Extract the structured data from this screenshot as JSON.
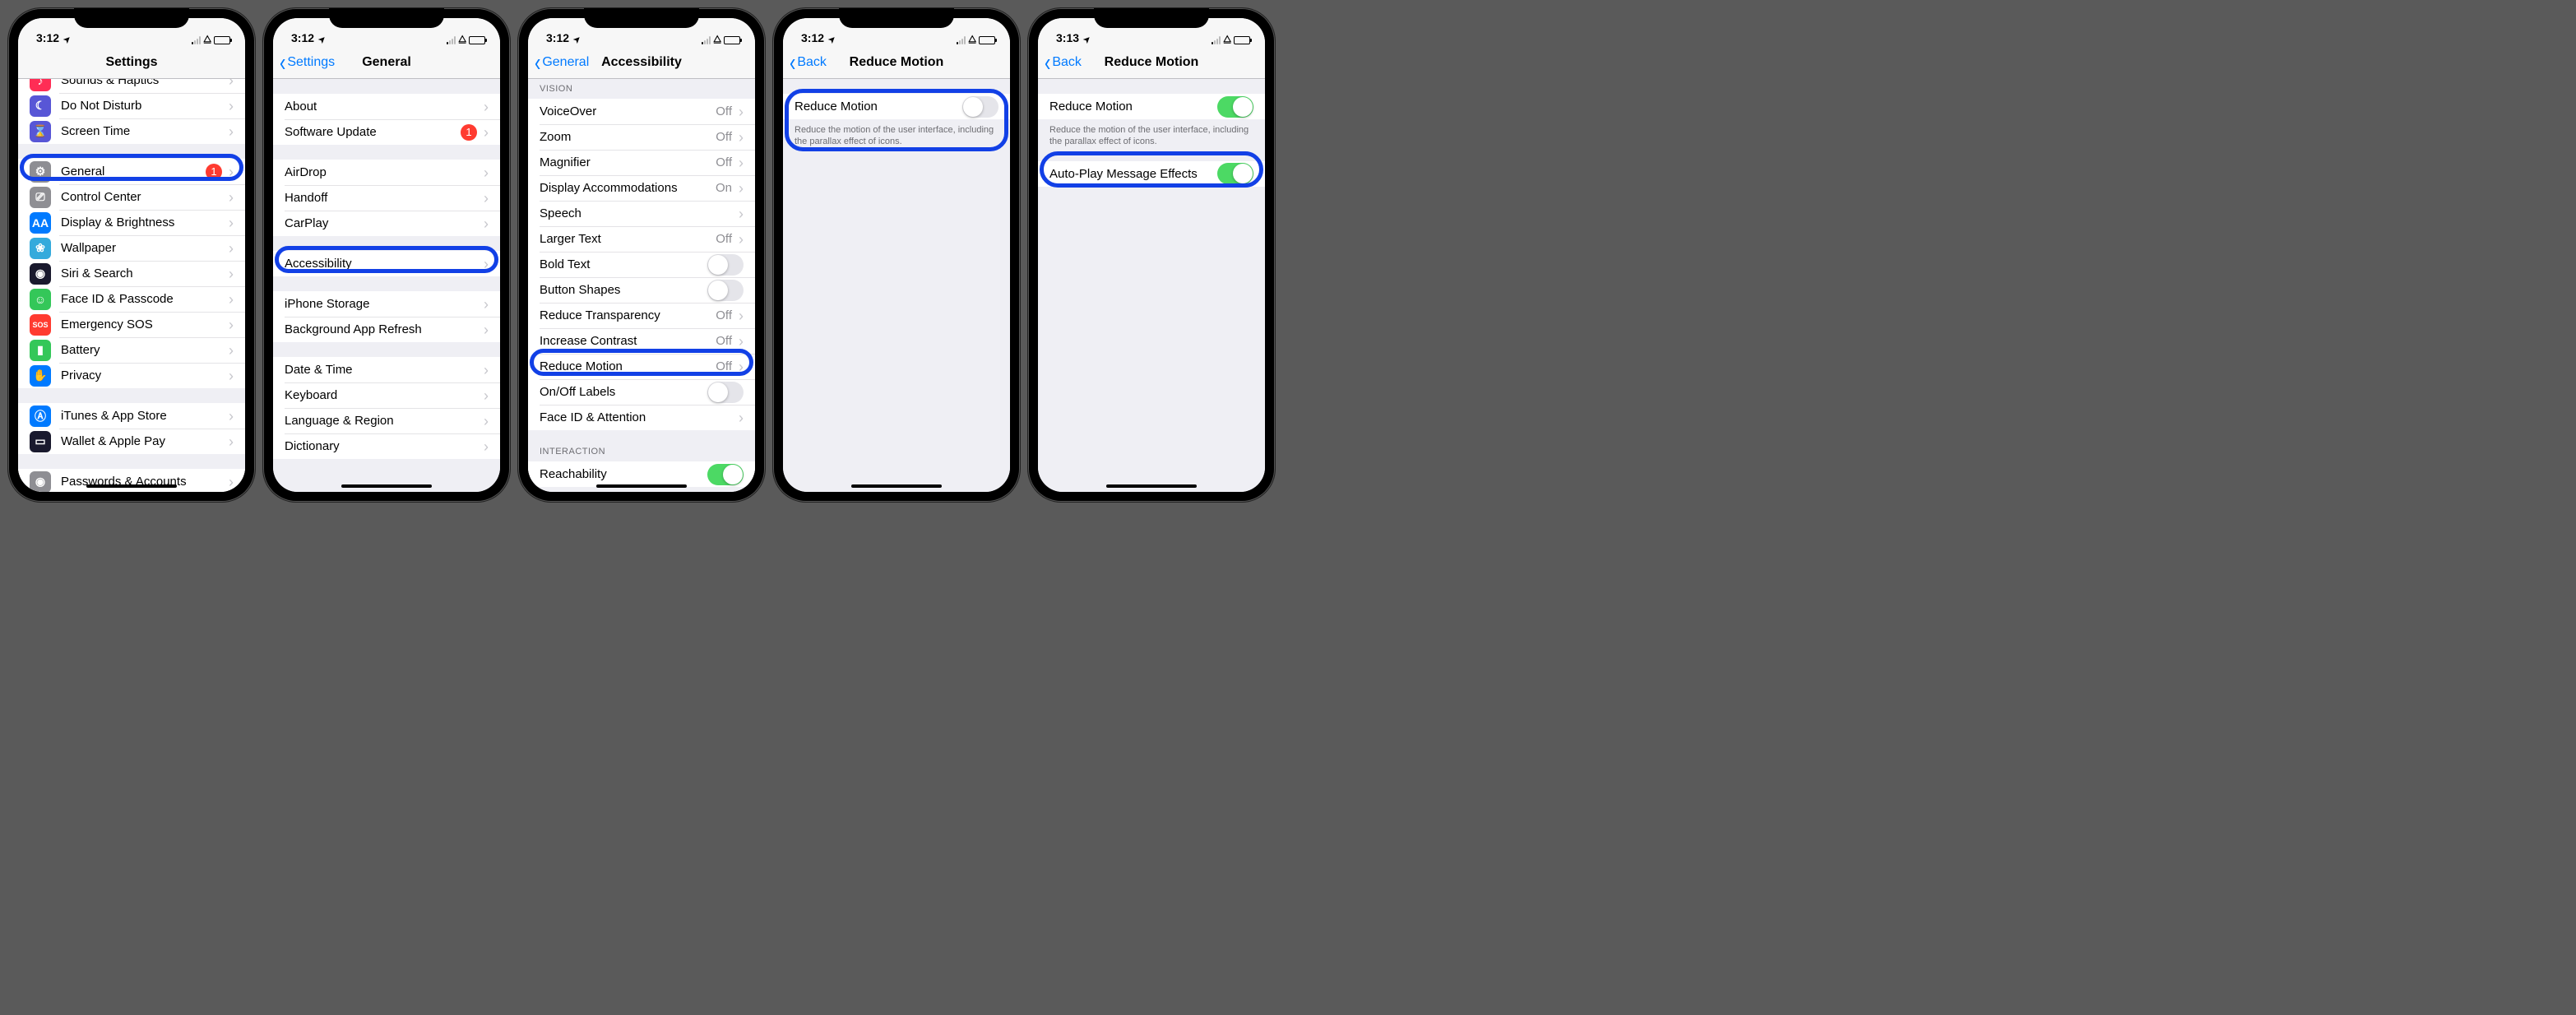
{
  "colors": {
    "highlight": "#1240e6",
    "ios_blue": "#007aff",
    "ios_green": "#4cd964",
    "badge_red": "#ff3b30"
  },
  "shared": {
    "location_arrow": "➤"
  },
  "screens": [
    {
      "time": "3:12",
      "title": "Settings",
      "back": null,
      "highlight_item": "General",
      "settings_rows": [
        {
          "icon_bg": "#ff2d55",
          "glyph": "♪",
          "label": "Sounds & Haptics",
          "cut_top": true
        },
        {
          "icon_bg": "#5856d6",
          "glyph": "☾",
          "label": "Do Not Disturb"
        },
        {
          "icon_bg": "#5856d6",
          "glyph": "⌛",
          "label": "Screen Time"
        },
        {
          "gap": true
        },
        {
          "icon_bg": "#8e8e93",
          "glyph": "⚙",
          "label": "General",
          "badge": "1"
        },
        {
          "icon_bg": "#8e8e93",
          "glyph": "⎚",
          "label": "Control Center"
        },
        {
          "icon_bg": "#007aff",
          "glyph": "AA",
          "label": "Display & Brightness"
        },
        {
          "icon_bg": "#34aadc",
          "glyph": "❀",
          "label": "Wallpaper"
        },
        {
          "icon_bg": "#1a1a2e",
          "glyph": "◉",
          "label": "Siri & Search"
        },
        {
          "icon_bg": "#34c759",
          "glyph": "☺",
          "label": "Face ID & Passcode"
        },
        {
          "icon_bg": "#ff3b30",
          "glyph": "SOS",
          "label": "Emergency SOS"
        },
        {
          "icon_bg": "#34c759",
          "glyph": "▮",
          "label": "Battery"
        },
        {
          "icon_bg": "#007aff",
          "glyph": "✋",
          "label": "Privacy"
        },
        {
          "gap": true
        },
        {
          "icon_bg": "#007aff",
          "glyph": "Ⓐ",
          "label": "iTunes & App Store"
        },
        {
          "icon_bg": "#1a1a2e",
          "glyph": "▭",
          "label": "Wallet & Apple Pay"
        },
        {
          "gap": true
        },
        {
          "icon_bg": "#8e8e93",
          "glyph": "◉",
          "label": "Passwords & Accounts",
          "cut_bottom": true
        }
      ]
    },
    {
      "time": "3:12",
      "title": "General",
      "back": "Settings",
      "highlight_item": "Accessibility",
      "general_groups": [
        [
          {
            "label": "About"
          },
          {
            "label": "Software Update",
            "badge": "1"
          }
        ],
        [
          {
            "label": "AirDrop"
          },
          {
            "label": "Handoff"
          },
          {
            "label": "CarPlay"
          }
        ],
        [
          {
            "label": "Accessibility"
          }
        ],
        [
          {
            "label": "iPhone Storage"
          },
          {
            "label": "Background App Refresh"
          }
        ],
        [
          {
            "label": "Date & Time"
          },
          {
            "label": "Keyboard"
          },
          {
            "label": "Language & Region"
          },
          {
            "label": "Dictionary"
          }
        ]
      ]
    },
    {
      "time": "3:12",
      "title": "Accessibility",
      "back": "General",
      "highlight_item": "Reduce Motion",
      "section_vision": "VISION",
      "section_interaction": "INTERACTION",
      "accessibility_rows": [
        {
          "label": "VoiceOver",
          "value": "Off",
          "chev": true
        },
        {
          "label": "Zoom",
          "value": "Off",
          "chev": true
        },
        {
          "label": "Magnifier",
          "value": "Off",
          "chev": true
        },
        {
          "label": "Display Accommodations",
          "value": "On",
          "chev": true
        },
        {
          "label": "Speech",
          "chev": true
        },
        {
          "label": "Larger Text",
          "value": "Off",
          "chev": true
        },
        {
          "label": "Bold Text",
          "switch": false
        },
        {
          "label": "Button Shapes",
          "switch": false
        },
        {
          "label": "Reduce Transparency",
          "value": "Off",
          "chev": true
        },
        {
          "label": "Increase Contrast",
          "value": "Off",
          "chev": true
        },
        {
          "label": "Reduce Motion",
          "value": "Off",
          "chev": true
        },
        {
          "label": "On/Off Labels",
          "switch": false
        },
        {
          "label": "Face ID & Attention",
          "chev": true
        }
      ],
      "interaction_rows": [
        {
          "label": "Reachability",
          "switch": true
        }
      ]
    },
    {
      "time": "3:12",
      "title": "Reduce Motion",
      "back": "Back",
      "highlight_item": "Reduce Motion",
      "reduce_motion_label": "Reduce Motion",
      "reduce_motion_on": false,
      "footer_text": "Reduce the motion of the user interface, including the parallax effect of icons."
    },
    {
      "time": "3:13",
      "title": "Reduce Motion",
      "back": "Back",
      "highlight_item": "Auto-Play Message Effects",
      "reduce_motion_label": "Reduce Motion",
      "reduce_motion_on": true,
      "footer_text": "Reduce the motion of the user interface, including the parallax effect of icons.",
      "autoplay_label": "Auto-Play Message Effects",
      "autoplay_on": true
    }
  ]
}
